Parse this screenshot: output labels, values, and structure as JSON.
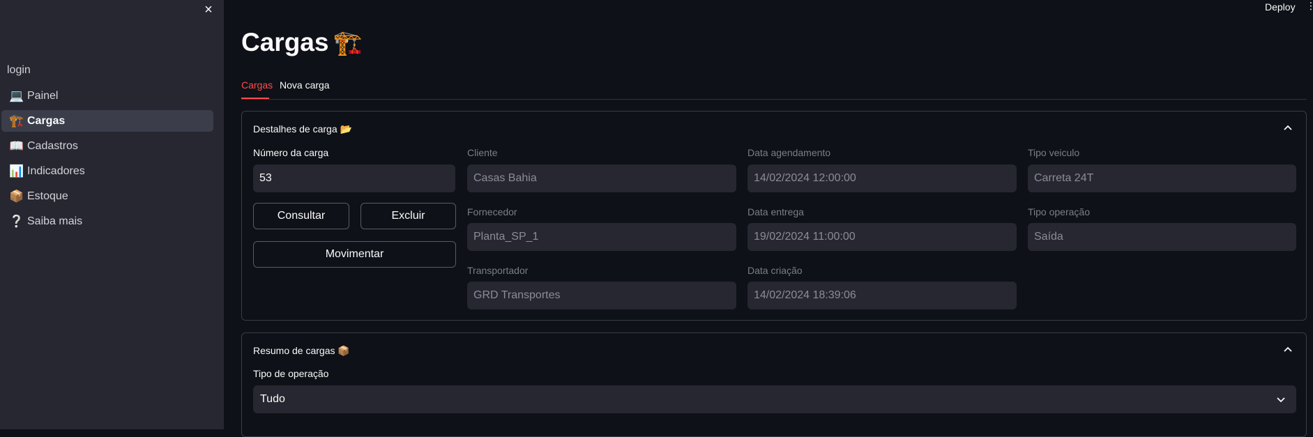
{
  "sidebar": {
    "close_icon": "×",
    "login_label": "login",
    "items": [
      {
        "icon": "💻",
        "label": "Painel",
        "active": false
      },
      {
        "icon": "🏗️",
        "label": "Cargas",
        "active": true
      },
      {
        "icon": "📖",
        "label": "Cadastros",
        "active": false
      },
      {
        "icon": "📊",
        "label": "Indicadores",
        "active": false
      },
      {
        "icon": "📦",
        "label": "Estoque",
        "active": false
      },
      {
        "icon": "❔",
        "label": "Saiba mais",
        "active": false
      }
    ]
  },
  "header": {
    "deploy_label": "Deploy",
    "menu_icon": "⋮"
  },
  "main": {
    "title": "Cargas",
    "title_icon": "🏗️",
    "tabs": [
      {
        "label": "Cargas",
        "active": true
      },
      {
        "label": "Nova carga",
        "active": false
      }
    ],
    "details": {
      "title": "Destalhes de carga 📂",
      "numero_label": "Número da carga",
      "numero_value": "53",
      "consultar_label": "Consultar",
      "excluir_label": "Excluir",
      "movimentar_label": "Movimentar",
      "cliente_label": "Cliente",
      "cliente_value": "Casas Bahia",
      "fornecedor_label": "Fornecedor",
      "fornecedor_value": "Planta_SP_1",
      "transportador_label": "Transportador",
      "transportador_value": "GRD Transportes",
      "data_agendamento_label": "Data agendamento",
      "data_agendamento_value": "14/02/2024 12:00:00",
      "data_entrega_label": "Data entrega",
      "data_entrega_value": "19/02/2024 11:00:00",
      "data_criacao_label": "Data criação",
      "data_criacao_value": "14/02/2024 18:39:06",
      "tipo_veiculo_label": "Tipo veiculo",
      "tipo_veiculo_value": "Carreta 24T",
      "tipo_operacao_label": "Tipo operação",
      "tipo_operacao_value": "Saída"
    },
    "resumo": {
      "title": "Resumo de cargas 📦",
      "tipo_label": "Tipo de operação",
      "tipo_value": "Tudo"
    }
  },
  "colors": {
    "background": "#0e1117",
    "sidebar": "#262730",
    "accent": "#ff4b4b"
  }
}
